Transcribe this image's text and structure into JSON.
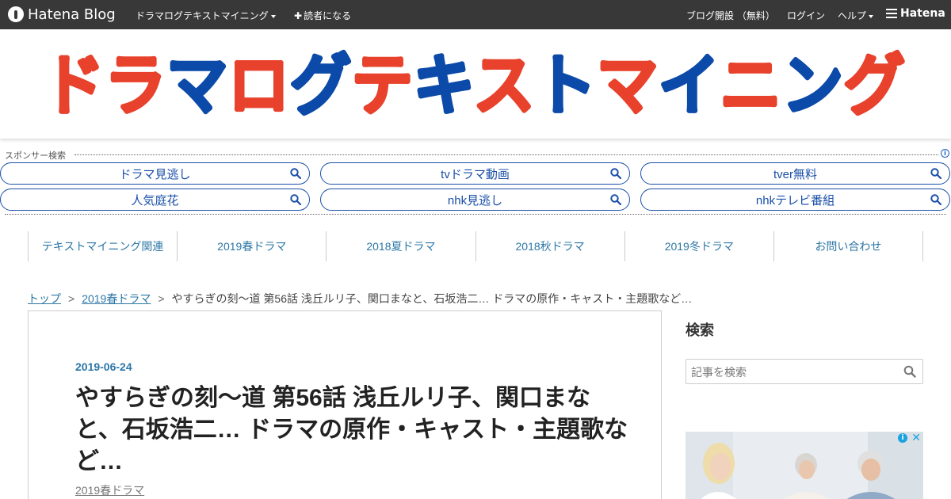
{
  "topbar": {
    "logo_text": "Hatena Blog",
    "blog_name": "ドラマログテキストマイニング",
    "subscribe": "読者になる",
    "open_blog": "ブログ開設 （無料）",
    "login": "ログイン",
    "help": "ヘルプ",
    "hatena": "Hatena"
  },
  "banner": {
    "title": "ドラマログテキストマイニング",
    "colors": {
      "red": "#e8412c",
      "blue": "#0b4aa8"
    }
  },
  "sponsor": {
    "label": "スポンサー検索",
    "pills": [
      "ドラマ見逃し",
      "tvドラマ動画",
      "tver無料",
      "人気庭花",
      "nhk見逃し",
      "nhkテレビ番組"
    ]
  },
  "nav": {
    "items": [
      "テキストマイニング関連",
      "2019春ドラマ",
      "2018夏ドラマ",
      "2018秋ドラマ",
      "2019冬ドラマ",
      "お問い合わせ"
    ]
  },
  "breadcrumb": {
    "top": "トップ",
    "sep": ">",
    "category": "2019春ドラマ",
    "current": "やすらぎの刻～道 第56話 浅丘ルリ子、関口まなと、石坂浩二… ドラマの原作・キャスト・主題歌など…"
  },
  "article": {
    "date": "2019-06-24",
    "title": "やすらぎの刻～道 第56話 浅丘ルリ子、関口まなと、石坂浩二… ドラマの原作・キャスト・主題歌など…",
    "category": "2019春ドラマ"
  },
  "sidebar": {
    "search_title": "検索",
    "search_placeholder": "記事を検索"
  }
}
